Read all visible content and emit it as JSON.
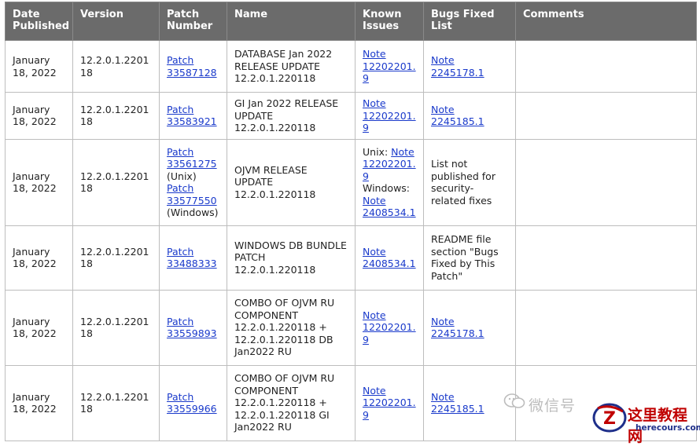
{
  "headers": {
    "date": "Date Published",
    "version": "Version",
    "patch": "Patch Number",
    "name": "Name",
    "known": "Known Issues",
    "bugs": "Bugs Fixed List",
    "comments": "Comments"
  },
  "rows": [
    {
      "date": "January 18, 2022",
      "version": "12.2.0.1.220118",
      "patch_link": "Patch 33587128",
      "name": "DATABASE Jan 2022 RELEASE UPDATE 12.2.0.1.220118",
      "known_link": "Note 12202201.9",
      "bugs_link": "Note 2245178.1"
    },
    {
      "date": "January 18, 2022",
      "version": "12.2.0.1.220118",
      "patch_link": "Patch 33583921",
      "name": "GI Jan 2022 RELEASE UPDATE 12.2.0.1.220118",
      "known_link": "Note 12202201.9",
      "bugs_link": "Note 2245185.1"
    },
    {
      "date": "January 18, 2022",
      "version": "12.2.0.1.220118",
      "patch_link_unix": "Patch 33561275",
      "unix_label": "(Unix)",
      "patch_link_windows": "Patch 33577550",
      "windows_label": "(Windows)",
      "name": "OJVM RELEASE UPDATE 12.2.0.1.220118",
      "known_unix_prefix": "Unix:",
      "known_link_unix": "Note 12202201.9",
      "known_windows_prefix": "Windows:",
      "known_link_windows": "Note 2408534.1",
      "bugs_text": "List not published for security-related fixes"
    },
    {
      "date": "January 18, 2022",
      "version": "12.2.0.1.220118",
      "patch_link": "Patch 33488333",
      "name": "WINDOWS DB BUNDLE PATCH 12.2.0.1.220118",
      "known_link": "Note 2408534.1",
      "bugs_text": "README file section \"Bugs Fixed by This Patch\""
    },
    {
      "date": "January 18, 2022",
      "version": "12.2.0.1.220118",
      "patch_link": "Patch 33559893",
      "name": "COMBO OF OJVM RU COMPONENT 12.2.0.1.220118 + 12.2.0.1.220118 DB Jan2022 RU",
      "known_link": "Note 12202201.9",
      "bugs_link": "Note 2245178.1"
    },
    {
      "date": "January 18, 2022",
      "version": "12.2.0.1.220118",
      "patch_link": "Patch 33559966",
      "name": "COMBO OF OJVM RU COMPONENT 12.2.0.1.220118 + 12.2.0.1.220118 GI Jan2022 RU",
      "known_link": "Note 12202201.9",
      "bugs_link": "Note 2245185.1"
    }
  ],
  "watermark": {
    "wechat_text": "微信号",
    "icon": "wechat-bubble-icon",
    "logo_icon": "z-logo-icon",
    "logo_cn": "这里教程网",
    "logo_en": "herecours.com"
  },
  "colors": {
    "header_bg": "#6b6b6b",
    "link": "#1a3acb",
    "logo_red": "#c00000",
    "logo_blue": "#1e2f8a"
  }
}
